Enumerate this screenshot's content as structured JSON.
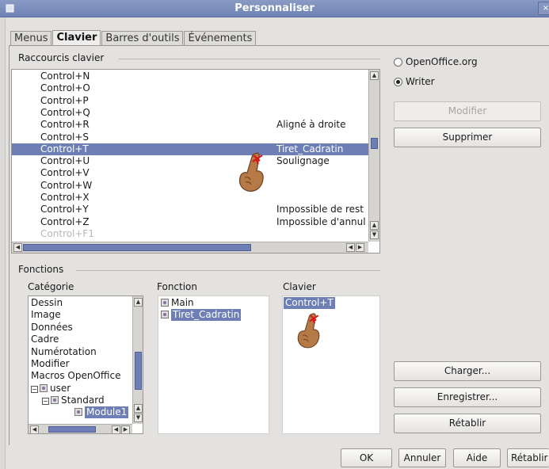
{
  "window": {
    "title": "Personnaliser"
  },
  "tabs": [
    "Menus",
    "Clavier",
    "Barres d'outils",
    "Événements"
  ],
  "shortcuts": {
    "group_label": "Raccourcis clavier",
    "rows": [
      {
        "key": "Control+N",
        "fn": ""
      },
      {
        "key": "Control+O",
        "fn": ""
      },
      {
        "key": "Control+P",
        "fn": ""
      },
      {
        "key": "Control+Q",
        "fn": ""
      },
      {
        "key": "Control+R",
        "fn": "Aligné à droite"
      },
      {
        "key": "Control+S",
        "fn": ""
      },
      {
        "key": "Control+T",
        "fn": "Tiret_Cadratin"
      },
      {
        "key": "Control+U",
        "fn": "Soulignage"
      },
      {
        "key": "Control+V",
        "fn": ""
      },
      {
        "key": "Control+W",
        "fn": ""
      },
      {
        "key": "Control+X",
        "fn": ""
      },
      {
        "key": "Control+Y",
        "fn": "Impossible de rest"
      },
      {
        "key": "Control+Z",
        "fn": "Impossible d'annul"
      },
      {
        "key": "Control+F1",
        "fn": ""
      }
    ],
    "selected_index": 6
  },
  "scope": {
    "options": [
      "OpenOffice.org",
      "Writer"
    ],
    "selected": "Writer"
  },
  "buttons": {
    "modifier": "Modifier",
    "supprimer": "Supprimer",
    "charger": "Charger...",
    "enregistrer": "Enregistrer...",
    "retablir_side": "Rétablir",
    "ok": "OK",
    "annuler": "Annuler",
    "aide": "Aide",
    "retablir_bottom": "Rétablir"
  },
  "functions": {
    "group_label": "Fonctions",
    "category_header": "Catégorie",
    "function_header": "Fonction",
    "keys_header": "Clavier",
    "categories": [
      "Dessin",
      "Image",
      "Données",
      "Cadre",
      "Numérotation",
      "Modifier",
      "Macros OpenOffice"
    ],
    "tree": {
      "user": "user",
      "standard": "Standard",
      "module": "Module1"
    },
    "function_items": [
      "Main",
      "Tiret_Cadratin"
    ],
    "key_items": [
      "Control+T"
    ]
  }
}
